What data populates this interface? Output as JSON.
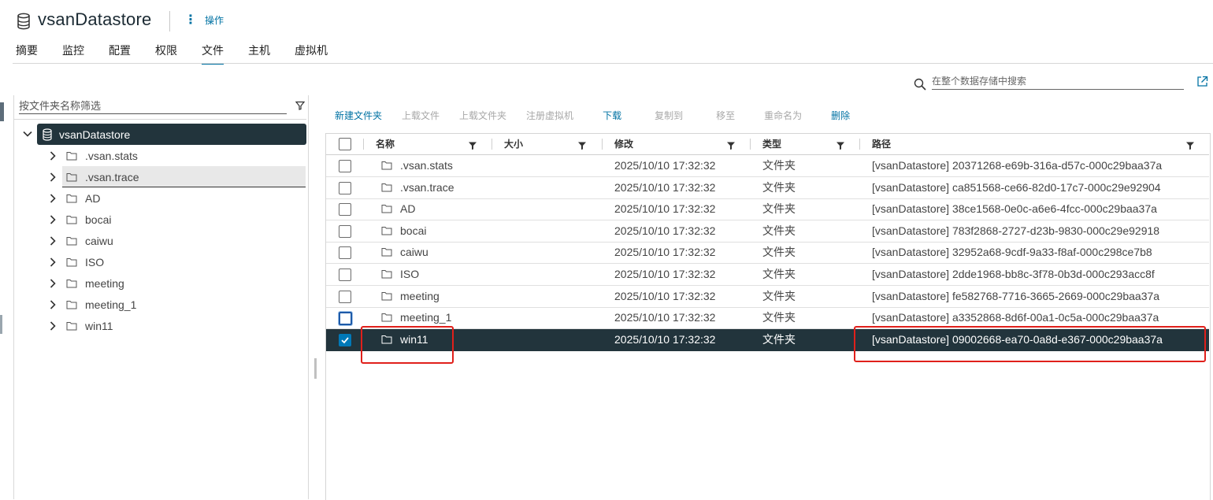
{
  "header": {
    "title": "vsanDatastore",
    "actions_label": "操作"
  },
  "tabs": [
    {
      "label": "摘要",
      "active": false
    },
    {
      "label": "监控",
      "active": false
    },
    {
      "label": "配置",
      "active": false
    },
    {
      "label": "权限",
      "active": false
    },
    {
      "label": "文件",
      "active": true
    },
    {
      "label": "主机",
      "active": false
    },
    {
      "label": "虚拟机",
      "active": false
    }
  ],
  "search": {
    "placeholder": "在整个数据存储中搜索"
  },
  "tree": {
    "filter_placeholder": "按文件夹名称筛选",
    "root": "vsanDatastore",
    "items": [
      {
        "label": ".vsan.stats",
        "selected": false
      },
      {
        "label": ".vsan.trace",
        "selected": true
      },
      {
        "label": "AD",
        "selected": false
      },
      {
        "label": "bocai",
        "selected": false
      },
      {
        "label": "caiwu",
        "selected": false
      },
      {
        "label": "ISO",
        "selected": false
      },
      {
        "label": "meeting",
        "selected": false
      },
      {
        "label": "meeting_1",
        "selected": false
      },
      {
        "label": "win11",
        "selected": false
      }
    ]
  },
  "toolbar": {
    "new_folder": "新建文件夹",
    "upload_file": "上载文件",
    "upload_folder": "上载文件夹",
    "register_vm": "注册虚拟机",
    "download": "下载",
    "copy_to": "复制到",
    "move_to": "移至",
    "rename": "重命名为",
    "delete": "删除"
  },
  "grid": {
    "columns": {
      "name": "名称",
      "size": "大小",
      "modified": "修改",
      "type": "类型",
      "path": "路径"
    },
    "rows": [
      {
        "name": ".vsan.stats",
        "size": "",
        "modified": "2025/10/10 17:32:32",
        "type": "文件夹",
        "path": "[vsanDatastore] 20371268-e69b-316a-d57c-000c29baa37a",
        "checked": false,
        "selected": false
      },
      {
        "name": ".vsan.trace",
        "size": "",
        "modified": "2025/10/10 17:32:32",
        "type": "文件夹",
        "path": "[vsanDatastore] ca851568-ce66-82d0-17c7-000c29e92904",
        "checked": false,
        "selected": false
      },
      {
        "name": "AD",
        "size": "",
        "modified": "2025/10/10 17:32:32",
        "type": "文件夹",
        "path": "[vsanDatastore] 38ce1568-0e0c-a6e6-4fcc-000c29baa37a",
        "checked": false,
        "selected": false
      },
      {
        "name": "bocai",
        "size": "",
        "modified": "2025/10/10 17:32:32",
        "type": "文件夹",
        "path": "[vsanDatastore] 783f2868-2727-d23b-9830-000c29e92918",
        "checked": false,
        "selected": false
      },
      {
        "name": "caiwu",
        "size": "",
        "modified": "2025/10/10 17:32:32",
        "type": "文件夹",
        "path": "[vsanDatastore] 32952a68-9cdf-9a33-f8af-000c298ce7b8",
        "checked": false,
        "selected": false
      },
      {
        "name": "ISO",
        "size": "",
        "modified": "2025/10/10 17:32:32",
        "type": "文件夹",
        "path": "[vsanDatastore] 2dde1968-bb8c-3f78-0b3d-000c293acc8f",
        "checked": false,
        "selected": false
      },
      {
        "name": "meeting",
        "size": "",
        "modified": "2025/10/10 17:32:32",
        "type": "文件夹",
        "path": "[vsanDatastore] fe582768-7716-3665-2669-000c29baa37a",
        "checked": false,
        "selected": false
      },
      {
        "name": "meeting_1",
        "size": "",
        "modified": "2025/10/10 17:32:32",
        "type": "文件夹",
        "path": "[vsanDatastore] a3352868-8d6f-00a1-0c5a-000c29baa37a",
        "checked": false,
        "selected": false,
        "focused": true
      },
      {
        "name": "win11",
        "size": "",
        "modified": "2025/10/10 17:32:32",
        "type": "文件夹",
        "path": "[vsanDatastore] 09002668-ea70-0a8d-e367-000c29baa37a",
        "checked": true,
        "selected": true
      }
    ]
  },
  "colors": {
    "accent": "#0072a3",
    "selected_row": "#22343c",
    "annotation": "#e0201b"
  }
}
